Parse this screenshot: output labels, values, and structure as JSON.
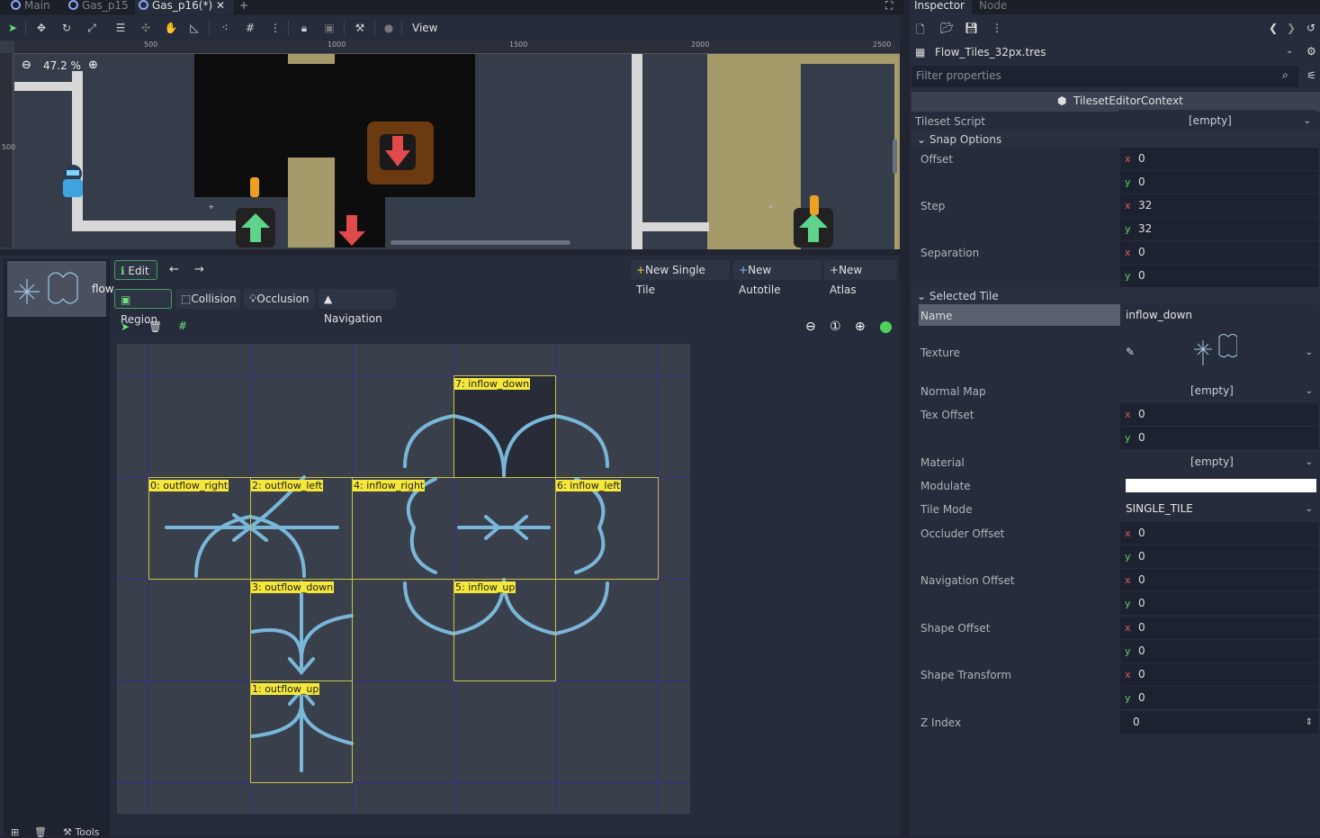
{
  "tabs": [
    {
      "label": "Main"
    },
    {
      "label": "Gas_p15"
    },
    {
      "label": "Gas_p16(*)"
    }
  ],
  "toolbar": {
    "view_label": "View"
  },
  "viewport": {
    "zoom": "47.2 %",
    "ruler_marks": [
      "500",
      "1000",
      "1500",
      "2000",
      "2500"
    ],
    "vruler_mark": "500"
  },
  "tileset_list": {
    "item_label": "flow"
  },
  "tile_editor": {
    "edit_label": "Edit",
    "new_single_tile": "New Single Tile",
    "new_autotile": "New Autotile",
    "new_atlas": "New Atlas",
    "modes": [
      "Region",
      "Collision",
      "Occlusion",
      "Navigation"
    ],
    "tiles": [
      {
        "label": "7: inflow_down"
      },
      {
        "label": "0: outflow_right"
      },
      {
        "label": "2: outflow_left"
      },
      {
        "label": "4: inflow_right"
      },
      {
        "label": "6: inflow_left"
      },
      {
        "label": "3: outflow_down"
      },
      {
        "label": "5: inflow_up"
      },
      {
        "label": "1: outflow_up"
      }
    ],
    "bottom_tools_label": "Tools"
  },
  "inspector": {
    "tabs": [
      "Inspector",
      "Node"
    ],
    "resource": "Flow_Tiles_32px.tres",
    "filter_placeholder": "Filter properties",
    "context": "TilesetEditorContext",
    "tileset_script_label": "Tileset Script",
    "tileset_script_value": "[empty]",
    "snap_section": "Snap Options",
    "offset_label": "Offset",
    "offset_x": "0",
    "offset_y": "0",
    "step_label": "Step",
    "step_x": "32",
    "step_y": "32",
    "separation_label": "Separation",
    "separation_x": "0",
    "separation_y": "0",
    "selected_section": "Selected Tile",
    "name_label": "Name",
    "name_value": "inflow_down",
    "texture_label": "Texture",
    "normal_map_label": "Normal Map",
    "normal_map_value": "[empty]",
    "tex_offset_label": "Tex Offset",
    "tex_offset_x": "0",
    "tex_offset_y": "0",
    "material_label": "Material",
    "material_value": "[empty]",
    "modulate_label": "Modulate",
    "modulate_color": "#ffffff",
    "tile_mode_label": "Tile Mode",
    "tile_mode_value": "SINGLE_TILE",
    "occluder_offset_label": "Occluder Offset",
    "occluder_x": "0",
    "occluder_y": "0",
    "navigation_offset_label": "Navigation Offset",
    "navigation_x": "0",
    "navigation_y": "0",
    "shape_offset_label": "Shape Offset",
    "shape_offset_x": "0",
    "shape_offset_y": "0",
    "shape_transform_label": "Shape Transform",
    "shape_transform_x": "0",
    "shape_transform_y": "0",
    "zindex_label": "Z Index",
    "zindex_value": "0",
    "axis_x": "x",
    "axis_y": "y"
  },
  "colors": {
    "accent_green": "#47a05a",
    "label_yellow": "#f5e83a",
    "grid_purple": "#3a2a8a",
    "background": "#202531"
  }
}
